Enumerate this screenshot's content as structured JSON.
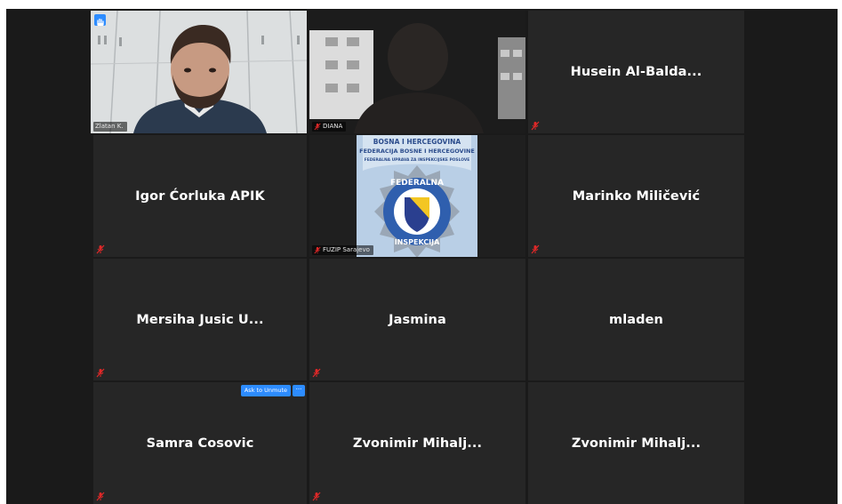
{
  "meeting": {
    "accent_color": "#2d8cff",
    "active_speaker_border": "#c7e48b",
    "muted_mic_color": "#e02828"
  },
  "tiles": [
    {
      "type": "video",
      "label": "Zlatan K.",
      "muted": false,
      "active_speaker": true,
      "hand_raised": true
    },
    {
      "type": "video",
      "label": "DIANA",
      "muted": true
    },
    {
      "type": "name",
      "name": "Husein  Al-Balda...",
      "muted": true
    },
    {
      "type": "name",
      "name": "Igor Ćorluka APIK",
      "muted": true
    },
    {
      "type": "logo",
      "label": "FUZIP Sarajevo",
      "muted": true,
      "logo": {
        "top_text_1": "BOSNA I HERCEGOVINA",
        "top_text_2": "FEDERACIJA BOSNE I HERCEGOVINE",
        "top_text_3": "FEDERALNA UPRAVA ZA INSPEKCIJSKE POSLOVE",
        "badge_top": "FEDERALNA",
        "badge_bottom": "INSPEKCIJA"
      }
    },
    {
      "type": "name",
      "name": "Marinko Miličević",
      "muted": true
    },
    {
      "type": "name",
      "name": "Mersiha Jusic U...",
      "muted": true
    },
    {
      "type": "name",
      "name": "Jasmina",
      "muted": true
    },
    {
      "type": "name",
      "name": "mladen",
      "muted": false
    },
    {
      "type": "name",
      "name": "Samra Cosovic",
      "muted": true,
      "ask_to_unmute": "Ask to Unmute",
      "more_label": "···"
    },
    {
      "type": "name",
      "name": "Zvonimir  Mihalj...",
      "muted": true
    },
    {
      "type": "name",
      "name": "Zvonimir  Mihalj...",
      "muted": false
    }
  ]
}
